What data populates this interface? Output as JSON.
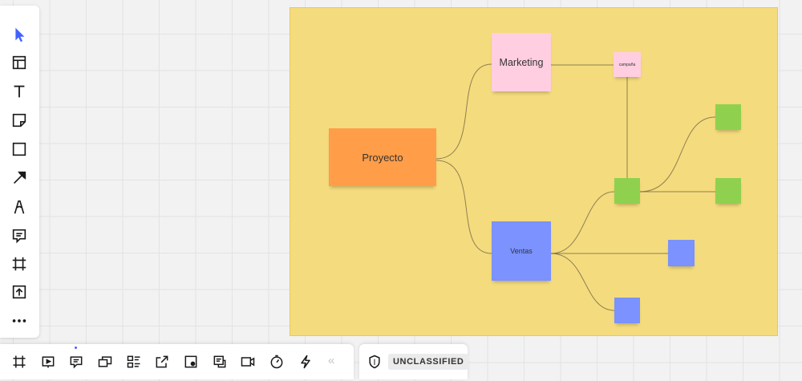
{
  "colors": {
    "frame": "#f4db7d",
    "orange": "#ff9d48",
    "pink": "#ffcee0",
    "blue": "#7b92ff",
    "green": "#8fd14f",
    "icon": "#1a1a1a",
    "accent": "#4262ff"
  },
  "left_toolbar": {
    "tools": [
      {
        "icon": "select-cursor-icon"
      },
      {
        "icon": "templates-icon"
      },
      {
        "icon": "text-icon"
      },
      {
        "icon": "sticky-note-icon"
      },
      {
        "icon": "shape-icon"
      },
      {
        "icon": "connection-line-icon"
      },
      {
        "icon": "pen-icon"
      },
      {
        "icon": "comment-icon"
      },
      {
        "icon": "frame-icon"
      },
      {
        "icon": "upload-icon"
      },
      {
        "icon": "more-icon"
      }
    ]
  },
  "board": {
    "notes": [
      {
        "id": "proyecto",
        "text": "Proyecto",
        "color": "orange"
      },
      {
        "id": "marketing",
        "text": "Marketing",
        "color": "pink"
      },
      {
        "id": "campana",
        "text": "campaña",
        "color": "pink"
      },
      {
        "id": "ventas",
        "text": "Ventas",
        "color": "blue"
      },
      {
        "id": "green-mid",
        "text": "",
        "color": "green"
      },
      {
        "id": "green-top",
        "text": "",
        "color": "green"
      },
      {
        "id": "green-right",
        "text": "",
        "color": "green"
      },
      {
        "id": "blue-right",
        "text": "",
        "color": "blue"
      },
      {
        "id": "blue-bottom",
        "text": "",
        "color": "blue"
      }
    ]
  },
  "bottom_toolbar": {
    "tools": [
      {
        "icon": "frames-icon"
      },
      {
        "icon": "presentation-icon"
      },
      {
        "icon": "comments-icon"
      },
      {
        "icon": "screen-share-icon"
      },
      {
        "icon": "card-list-icon"
      },
      {
        "icon": "share-external-icon"
      },
      {
        "icon": "screenshot-icon"
      },
      {
        "icon": "chat-icon"
      },
      {
        "icon": "video-call-icon"
      },
      {
        "icon": "timer-icon"
      },
      {
        "icon": "lightning-icon"
      }
    ],
    "collapse_label": "«"
  },
  "classification": {
    "label": "UNCLASSIFIED"
  }
}
